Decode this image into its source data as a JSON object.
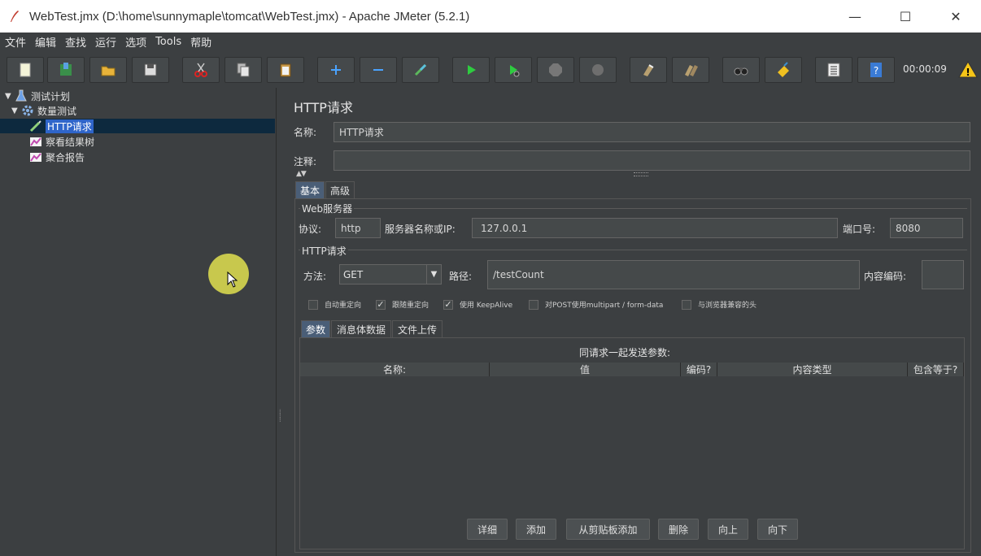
{
  "window": {
    "title": "WebTest.jmx (D:\\home\\sunnymaple\\tomcat\\WebTest.jmx) - Apache JMeter (5.2.1)",
    "minimize": "—",
    "maximize": "☐",
    "close": "✕"
  },
  "menu": [
    "文件",
    "编辑",
    "查找",
    "运行",
    "选项",
    "Tools",
    "帮助"
  ],
  "toolbar": {
    "buttons": [
      "new-icon",
      "templates-icon",
      "open-icon",
      "save-icon",
      "cut-icon",
      "copy-icon",
      "paste-icon",
      "expand-icon",
      "collapse-icon",
      "toggle-icon",
      "start-icon",
      "start-no-pause-icon",
      "stop-icon",
      "shutdown-icon",
      "clear-icon",
      "clear-all-icon",
      "search-icon",
      "reset-search-icon",
      "function-helper-icon",
      "help-icon"
    ],
    "timer": "00:00:09",
    "warning_icon": "warning-icon"
  },
  "tree": {
    "test_plan": "测试计划",
    "thread_group": "数量测试",
    "http_request": "HTTP请求",
    "view_results_tree": "察看结果树",
    "aggregate_report": "聚合报告"
  },
  "main": {
    "title": "HTTP请求",
    "name_label": "名称:",
    "name_value": "HTTP请求",
    "comment_label": "注释:",
    "comment_value": "",
    "tabs": [
      "基本",
      "高级"
    ],
    "web_server": {
      "title": "Web服务器",
      "protocol_label": "协议:",
      "protocol_value": "http",
      "server_label": "服务器名称或IP:",
      "server_value": "127.0.0.1",
      "port_label": "端口号:",
      "port_value": "8080"
    },
    "http_request": {
      "title": "HTTP请求",
      "method_label": "方法:",
      "method_value": "GET",
      "path_label": "路径:",
      "path_value": "/testCount",
      "encoding_label": "内容编码:",
      "encoding_value": ""
    },
    "options": [
      {
        "label": "自动重定向",
        "checked": false
      },
      {
        "label": "跟随重定向",
        "checked": true
      },
      {
        "label": "使用 KeepAlive",
        "checked": true
      },
      {
        "label": "对POST使用multipart / form-data",
        "checked": false
      },
      {
        "label": "与浏览器兼容的头",
        "checked": false
      }
    ],
    "subtabs": [
      "参数",
      "消息体数据",
      "文件上传"
    ],
    "params": {
      "caption": "同请求一起发送参数:",
      "columns": [
        "名称:",
        "值",
        "编码?",
        "内容类型",
        "包含等于?"
      ]
    },
    "buttons": [
      "详细",
      "添加",
      "从剪贴板添加",
      "删除",
      "向上",
      "向下"
    ]
  }
}
